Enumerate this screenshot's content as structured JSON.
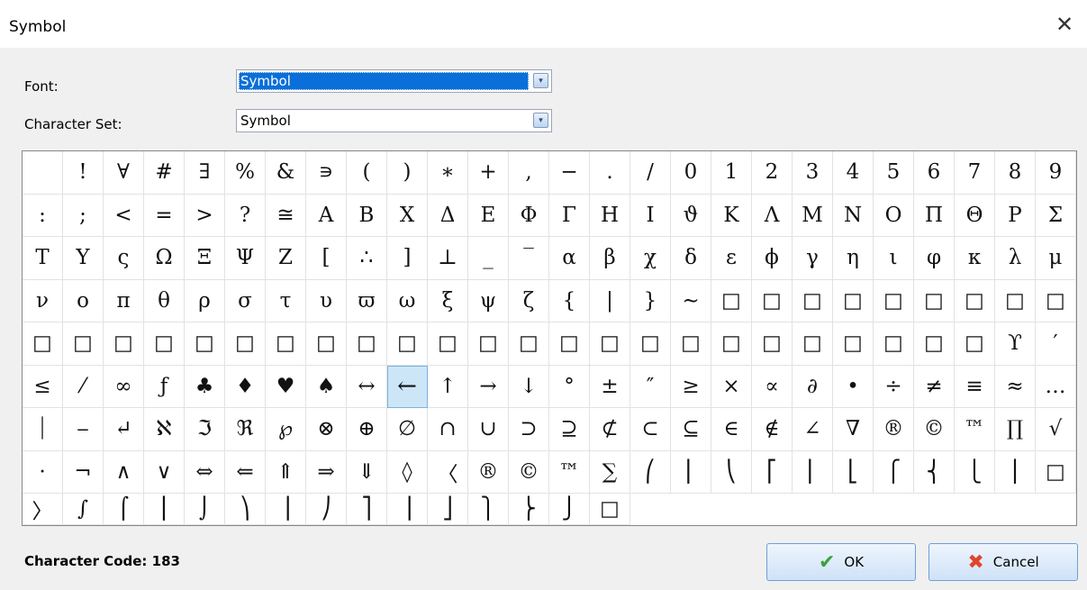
{
  "window": {
    "title": "Symbol",
    "close_glyph": "✕"
  },
  "font": {
    "label": "Font:",
    "value": "Symbol"
  },
  "charset": {
    "label": "Character Set:",
    "value": "Symbol"
  },
  "dropdown_glyph": "▾",
  "grid": {
    "columns": 26,
    "selected_index": 139,
    "cells": [
      " ",
      "!",
      "∀",
      "#",
      "∃",
      "%",
      "&",
      "∍",
      "(",
      ")",
      "∗",
      "+",
      ",",
      "−",
      ".",
      "/",
      "0",
      "1",
      "2",
      "3",
      "4",
      "5",
      "6",
      "7",
      "8",
      "9",
      ":",
      ";",
      "<",
      "=",
      ">",
      "?",
      "≅",
      "Α",
      "Β",
      "Χ",
      "Δ",
      "Ε",
      "Φ",
      "Γ",
      "Η",
      "Ι",
      "ϑ",
      "Κ",
      "Λ",
      "Μ",
      "Ν",
      "Ο",
      "Π",
      "Θ",
      "Ρ",
      "Σ",
      "Τ",
      "Υ",
      "ς",
      "Ω",
      "Ξ",
      "Ψ",
      "Ζ",
      "[",
      "∴",
      "]",
      "⊥",
      "_",
      "‾",
      "α",
      "β",
      "χ",
      "δ",
      "ε",
      "ϕ",
      "γ",
      "η",
      "ι",
      "φ",
      "κ",
      "λ",
      "μ",
      "ν",
      "ο",
      "π",
      "θ",
      "ρ",
      "σ",
      "τ",
      "υ",
      "ϖ",
      "ω",
      "ξ",
      "ψ",
      "ζ",
      "{",
      "|",
      "}",
      "∼",
      "□",
      "□",
      "□",
      "□",
      "□",
      "□",
      "□",
      "□",
      "□",
      "□",
      "□",
      "□",
      "□",
      "□",
      "□",
      "□",
      "□",
      "□",
      "□",
      "□",
      "□",
      "□",
      "□",
      "□",
      "□",
      "□",
      "□",
      "□",
      "□",
      "□",
      "□",
      "□",
      "□",
      "ϒ",
      "′",
      "≤",
      "⁄",
      "∞",
      "ƒ",
      "♣",
      "♦",
      "♥",
      "♠",
      "↔",
      "←",
      "↑",
      "→",
      "↓",
      "°",
      "±",
      "″",
      "≥",
      "×",
      "∝",
      "∂",
      "•",
      "÷",
      "≠",
      "≡",
      "≈",
      "…",
      "⏐",
      "⎯",
      "↵",
      "ℵ",
      "ℑ",
      "ℜ",
      "℘",
      "⊗",
      "⊕",
      "∅",
      "∩",
      "∪",
      "⊃",
      "⊇",
      "⊄",
      "⊂",
      "⊆",
      "∈",
      "∉",
      "∠",
      "∇",
      "®",
      "©",
      "™",
      "∏",
      "√",
      "⋅",
      "¬",
      "∧",
      "∨",
      "⇔",
      "⇐",
      "⇑",
      "⇒",
      "⇓",
      "◊",
      "〈",
      "®",
      "©",
      "™",
      "∑",
      "⎛",
      "⎜",
      "⎝",
      "⎡",
      "⎢",
      "⎣",
      "⎧",
      "⎨",
      "⎩",
      "⎪",
      "□",
      "〉",
      "∫",
      "⌠",
      "⎮",
      "⌡",
      "⎞",
      "⎟",
      "⎠",
      "⎤",
      "⎥",
      "⎦",
      "⎫",
      "⎬",
      "⎭",
      "□"
    ]
  },
  "status": {
    "character_code": "Character Code: 183"
  },
  "buttons": {
    "ok": {
      "label": "OK",
      "icon": "✔"
    },
    "cancel": {
      "label": "Cancel",
      "icon": "✖"
    }
  }
}
